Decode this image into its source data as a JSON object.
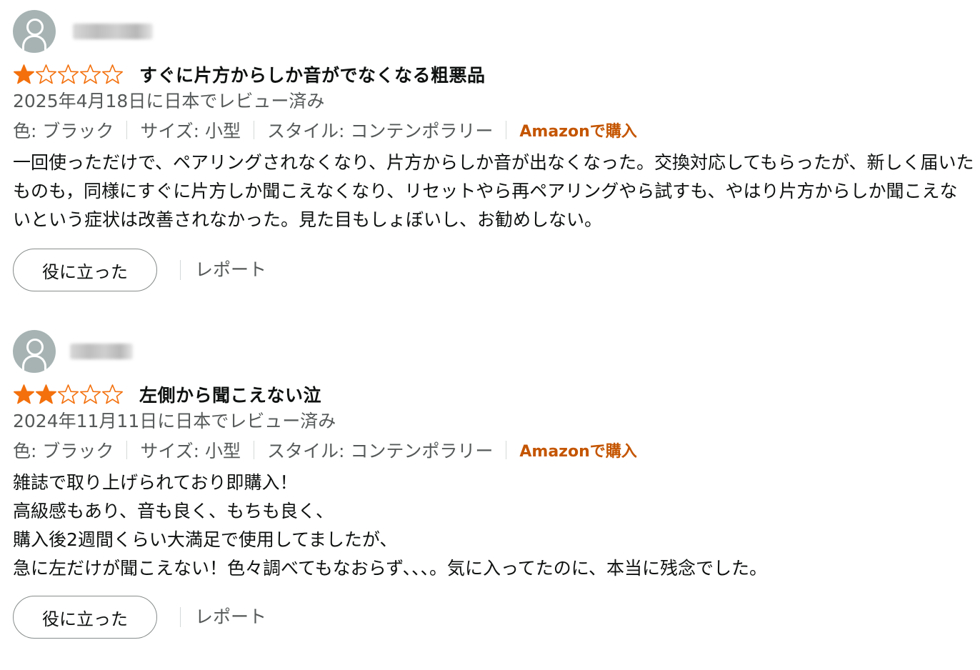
{
  "reviews": [
    {
      "rating": 1,
      "max_rating": 5,
      "title": "すぐに片方からしか音がでなくなる粗悪品",
      "date": "2025年4月18日に日本でレビュー済み",
      "variant": {
        "color": "色: ブラック",
        "size": "サイズ: 小型",
        "style": "スタイル: コンテンポラリー"
      },
      "verified_label": "Amazonで購入",
      "body": "一回使っただけで、ペアリングされなくなり、片方からしか音が出なくなった。交換対応してもらったが、新しく届いたものも，同様にすぐに片方しか聞こえなくなり、リセットやら再ペアリングやら試すも、やはり片方からしか聞こえないという症状は改善されなかった。見た目もしょぼいし、お勧めしない。",
      "helpful_label": "役に立った",
      "report_label": "レポート"
    },
    {
      "rating": 2,
      "max_rating": 5,
      "title": "左側から聞こえない泣",
      "date": "2024年11月11日に日本でレビュー済み",
      "variant": {
        "color": "色: ブラック",
        "size": "サイズ: 小型",
        "style": "スタイル: コンテンポラリー"
      },
      "verified_label": "Amazonで購入",
      "body": "雑誌で取り上げられており即購入！\n高級感もあり、音も良く、もちも良く、\n購入後2週間くらい大満足で使用してましたが、\n急に左だけが聞こえない！色々調べてもなおらず、、、。気に入ってたのに、本当に残念でした。",
      "helpful_label": "役に立った",
      "report_label": "レポート"
    }
  ],
  "colors": {
    "star_filled": "#f3700d",
    "star_outline": "#f3700d",
    "verified": "#c45500",
    "muted_text": "#565959",
    "avatar_bg": "#a7b3b3"
  },
  "icons": {
    "avatar": "user-silhouette-icon",
    "star_filled": "star-filled-icon",
    "star_empty": "star-empty-icon"
  }
}
